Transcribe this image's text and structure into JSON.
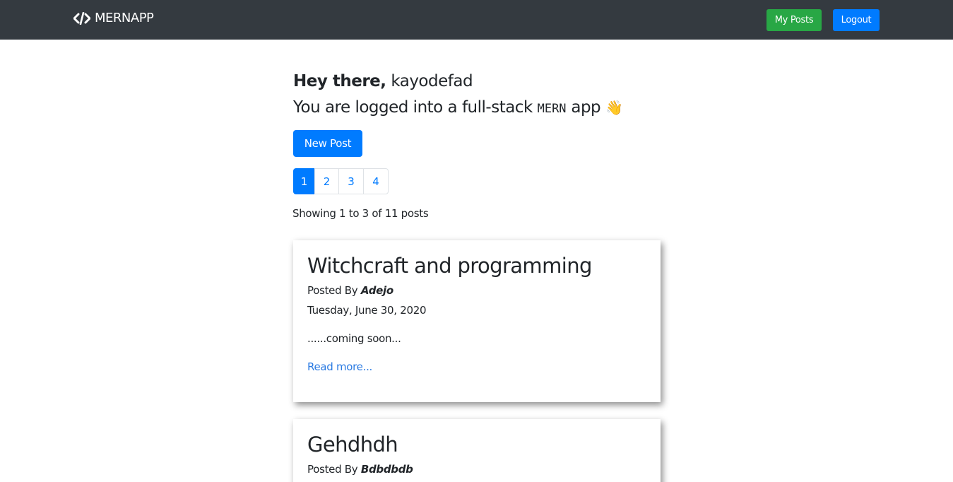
{
  "navbar": {
    "brand_text": "MERNAPP",
    "my_posts_label": "My Posts",
    "logout_label": "Logout"
  },
  "greeting": {
    "hey": "Hey there,",
    "username": "kayodefad",
    "line2_prefix": "You are logged into a full-stack",
    "line2_code": "MERN",
    "line2_suffix": "app",
    "wave_emoji": "👋"
  },
  "new_post_label": "New Post",
  "pagination": {
    "pages": [
      "1",
      "2",
      "3",
      "4"
    ],
    "active_page": "1"
  },
  "showing_text": "Showing 1 to 3 of 11 posts",
  "posts": [
    {
      "title": "Witchcraft and programming",
      "posted_by_label": "Posted By",
      "author": "Adejo",
      "date": "Tuesday, June 30, 2020",
      "excerpt": "......coming soon...",
      "read_more": "Read more..."
    },
    {
      "title": "Gehdhdh",
      "posted_by_label": "Posted By",
      "author": "Bdbdbdb"
    }
  ],
  "colors": {
    "navbar_bg": "#343a40",
    "primary": "#007bff",
    "success": "#28a745",
    "link": "#2a7ae2"
  },
  "icons": {
    "brand": "code-icon"
  }
}
